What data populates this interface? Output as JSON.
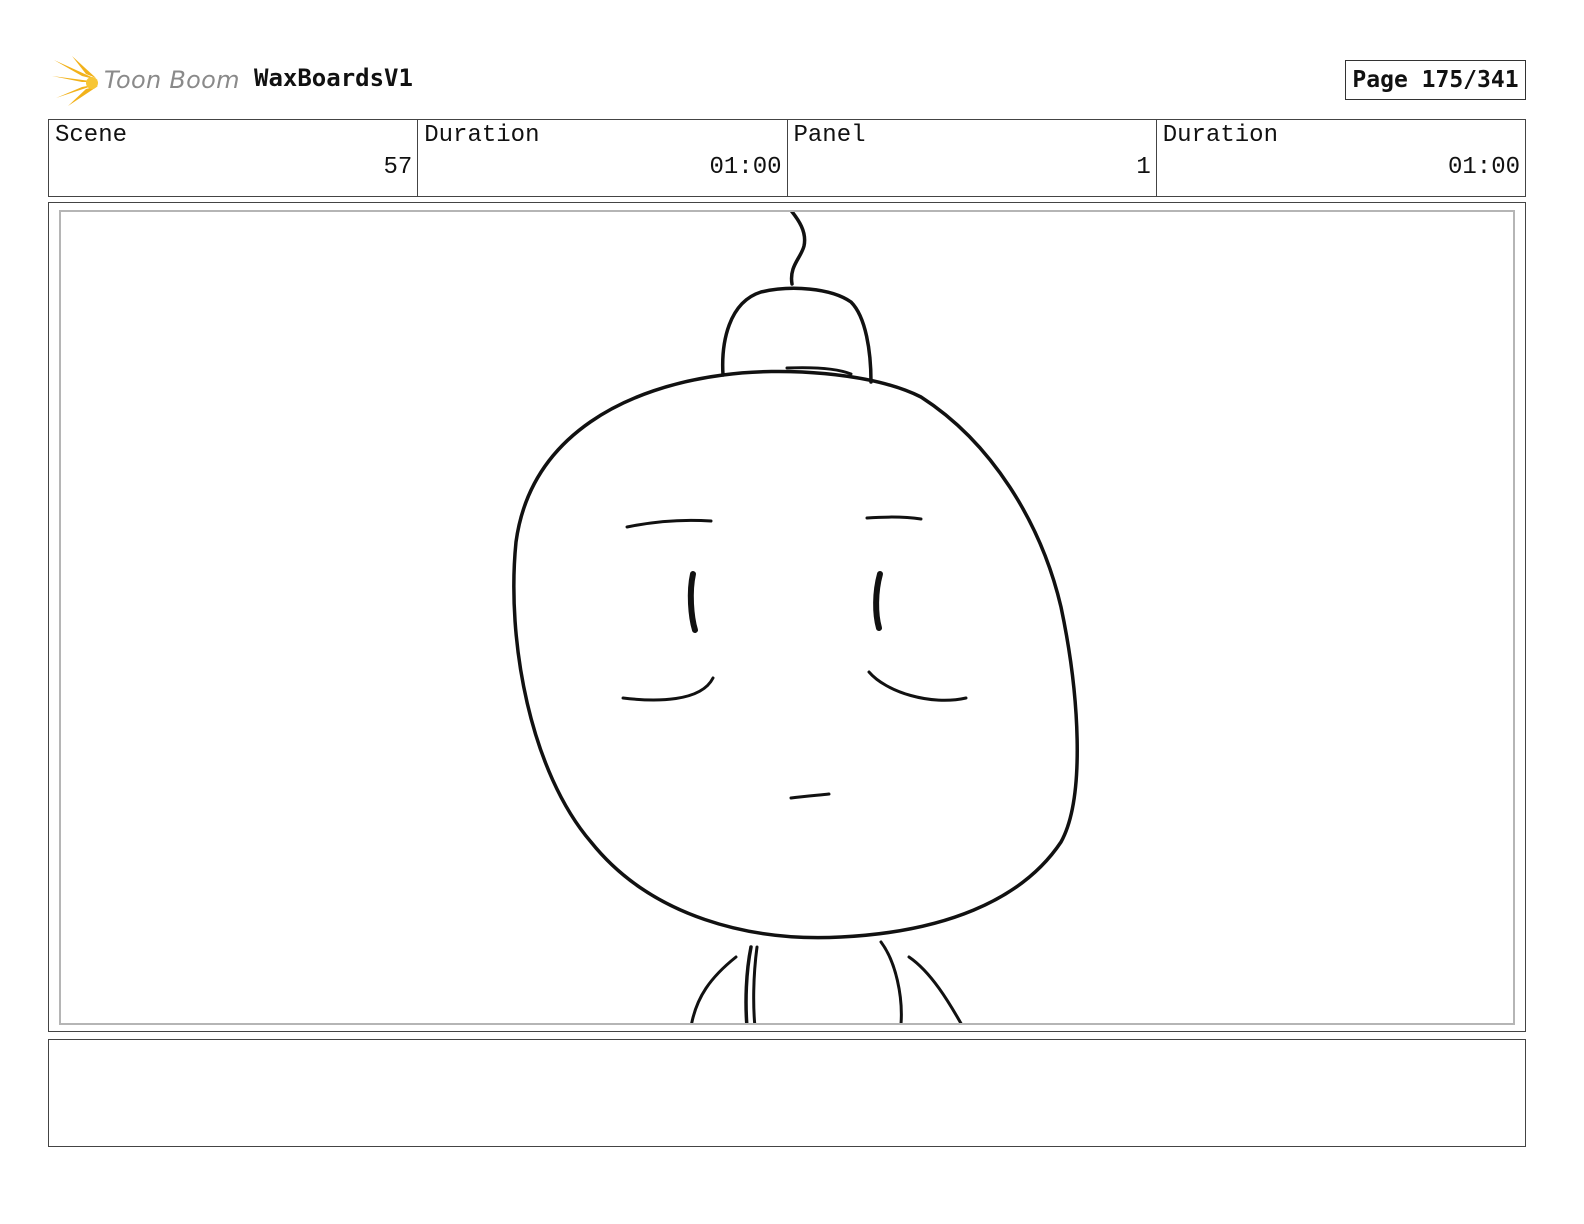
{
  "header": {
    "logo_text": "Toon Boom",
    "project_title": "WaxBoardsV1",
    "page_label": "Page 175/341"
  },
  "info": {
    "scene_label": "Scene",
    "scene_value": "57",
    "scene_duration_label": "Duration",
    "scene_duration_value": "01:00",
    "panel_label": "Panel",
    "panel_value": "1",
    "panel_duration_label": "Duration",
    "panel_duration_value": "01:00"
  },
  "panel": {
    "drawing": "character-face-sketch"
  },
  "notes": {
    "text": ""
  }
}
